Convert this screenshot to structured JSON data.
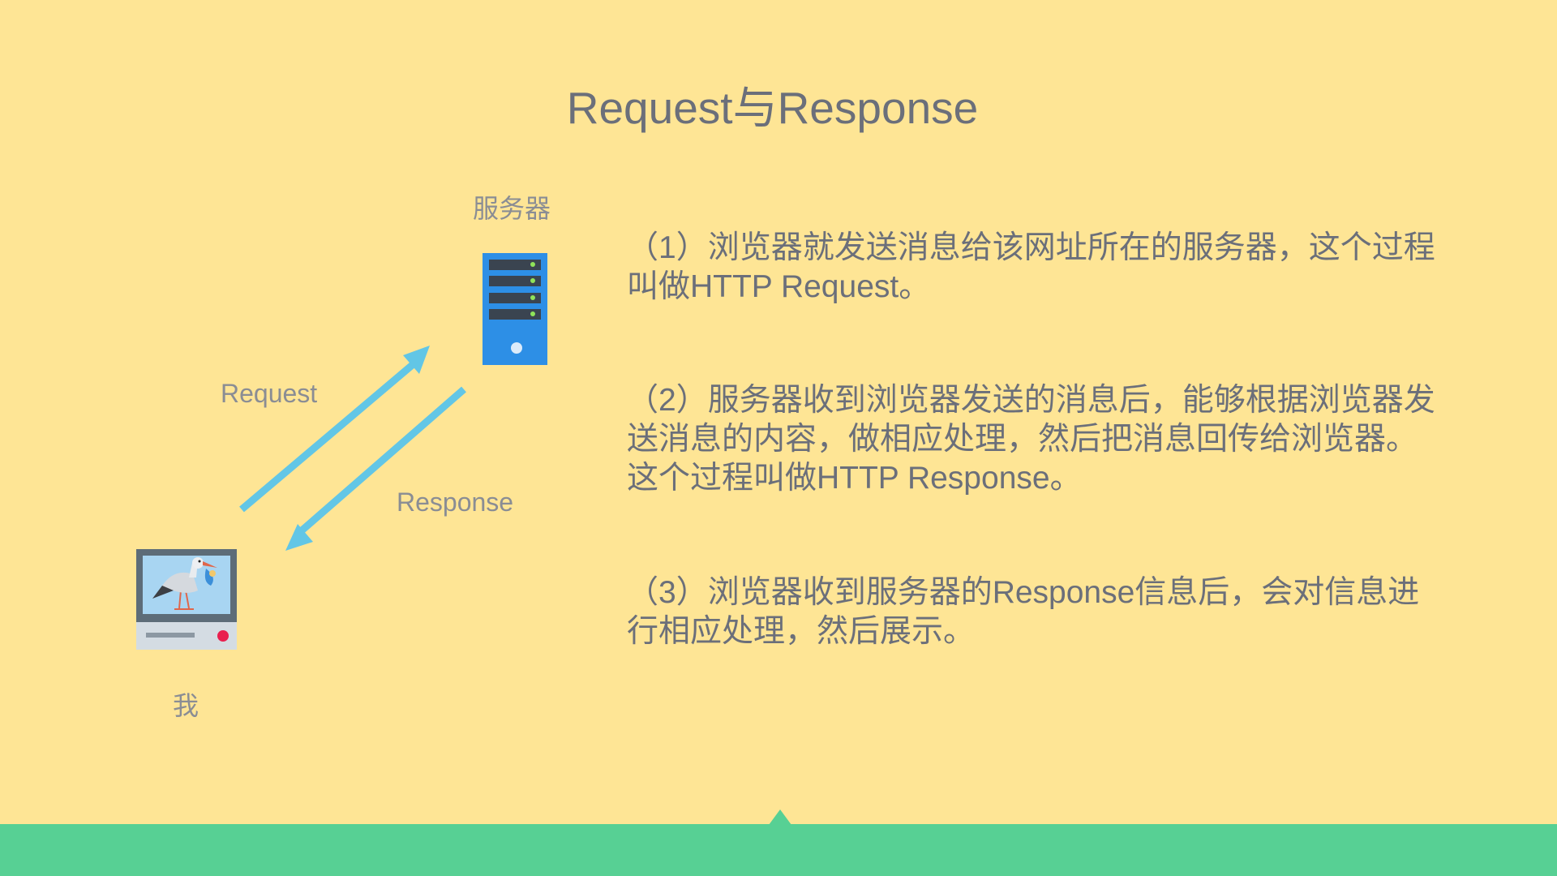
{
  "slide": {
    "title": "Request与Response"
  },
  "diagram": {
    "server_label": "服务器",
    "client_label": "我",
    "request_label": "Request",
    "response_label": "Response"
  },
  "steps": [
    {
      "text": "（1）浏览器就发送消息给该网址所在的服务器，这个过程叫做HTTP Request。"
    },
    {
      "text": "（2）服务器收到浏览器发送的消息后，能够根据浏览器发送消息的内容，做相应处理，然后把消息回传给浏览器。这个过程叫做HTTP Response。"
    },
    {
      "text": "（3）浏览器收到服务器的Response信息后，会对信息进行相应处理，然后展示。"
    }
  ],
  "colors": {
    "background": "#FEE595",
    "footer": "#57D094",
    "arrow": "#62C6E6",
    "server": "#2D8FE6",
    "text": "#6B6F7A"
  }
}
